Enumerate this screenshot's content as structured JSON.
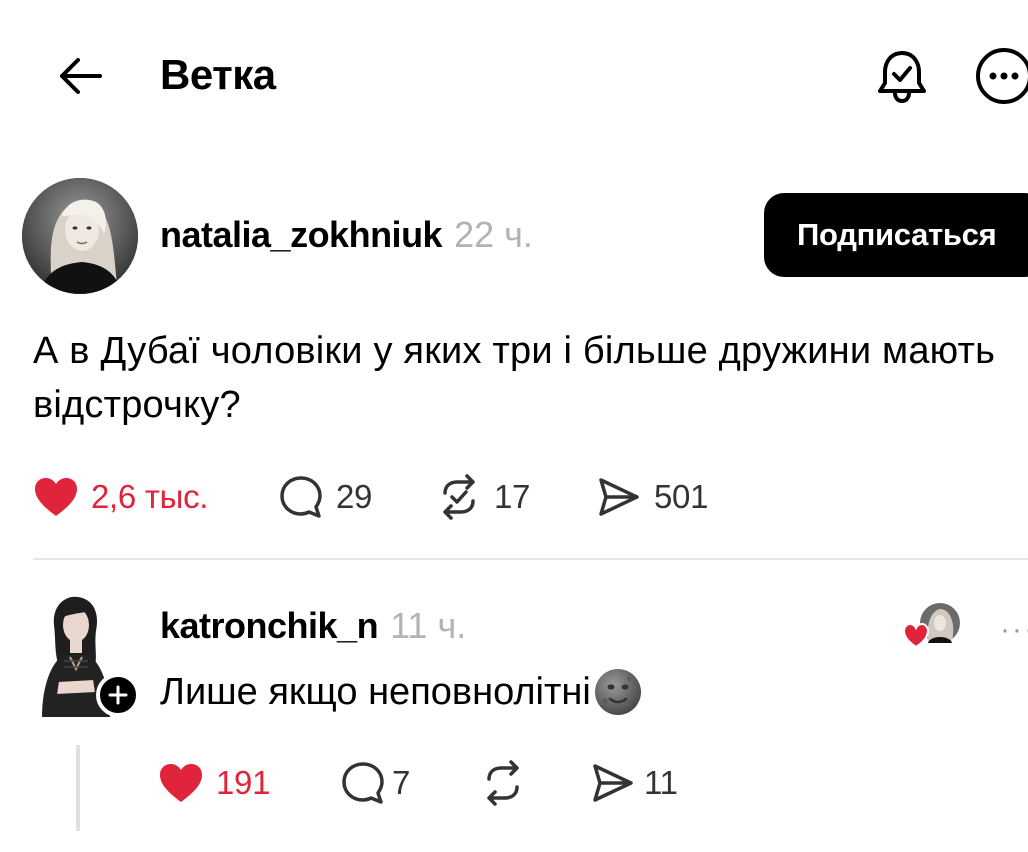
{
  "header": {
    "title": "Ветка",
    "back_icon": "arrow-left-icon",
    "bell_icon": "bell-check-icon",
    "more_icon": "more-horizontal-icon"
  },
  "main_post": {
    "author": "natalia_zokhniuk",
    "time": "22 ч.",
    "follow_label": "Подписаться",
    "text": "А в Дубаї чоловіки у яких три і більше дружини мають відстрочку?",
    "likes": "2,6 тыс.",
    "comments": "29",
    "reposts": "17",
    "shares": "501",
    "liked": true
  },
  "reply": {
    "author": "katronchik_n",
    "time": "11 ч.",
    "text": "Лише якщо неповнолітні",
    "more_label": "···",
    "likes": "191",
    "comments": "7",
    "shares": "11",
    "liked": true
  },
  "colors": {
    "accent_like": "#e0243b",
    "text_secondary": "#b3b3b3",
    "button_bg": "#000000"
  }
}
